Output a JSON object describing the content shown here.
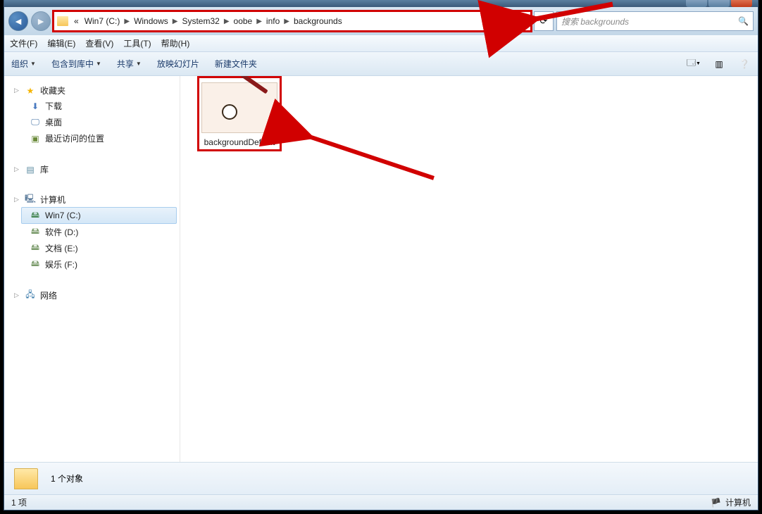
{
  "breadcrumb": {
    "root": "«",
    "drive": "Win7 (C:)",
    "p1": "Windows",
    "p2": "System32",
    "p3": "oobe",
    "p4": "info",
    "p5": "backgrounds"
  },
  "search": {
    "placeholder": "搜索 backgrounds"
  },
  "menu": {
    "file": "文件(F)",
    "edit": "编辑(E)",
    "view": "查看(V)",
    "tools": "工具(T)",
    "help": "帮助(H)"
  },
  "toolbar": {
    "organize": "组织",
    "include": "包含到库中",
    "share": "共享",
    "slideshow": "放映幻灯片",
    "newfolder": "新建文件夹"
  },
  "sidebar": {
    "favorites": "收藏夹",
    "downloads": "下载",
    "desktop": "桌面",
    "recent": "最近访问的位置",
    "libraries": "库",
    "computer": "计算机",
    "drives": {
      "c": "Win7 (C:)",
      "d": "软件 (D:)",
      "e": "文档 (E:)",
      "f": "娱乐 (F:)"
    },
    "network": "网络"
  },
  "file": {
    "name": "backgroundDefault"
  },
  "details": {
    "count": "1 个对象"
  },
  "status": {
    "left": "1 项",
    "right": "计算机"
  }
}
